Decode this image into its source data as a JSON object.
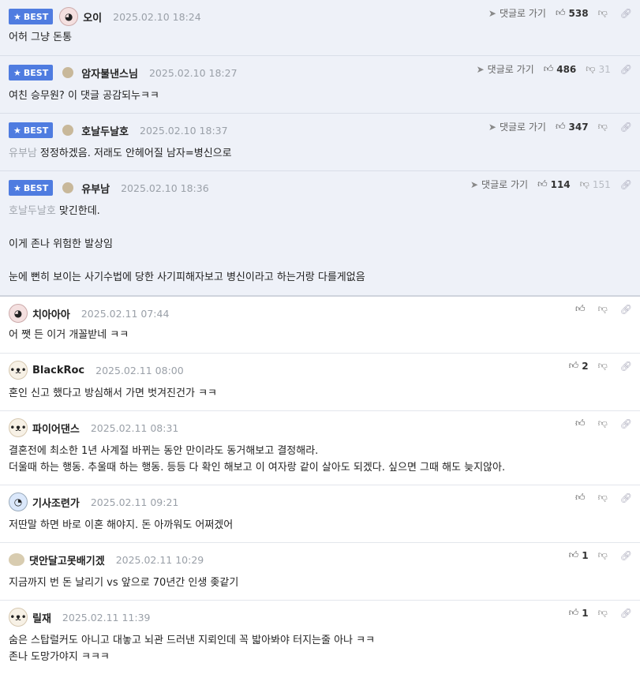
{
  "best_label": "BEST",
  "goto_label": "댓글로 가기",
  "best_comments": [
    {
      "nick": "오이",
      "date": "2025.02.10 18:24",
      "up": "538",
      "down": "",
      "mention": "",
      "lines": [
        "어허 그냥 돈통"
      ]
    },
    {
      "nick": "암자불낸스님",
      "date": "2025.02.10 18:27",
      "up": "486",
      "down": "31",
      "mention": "",
      "lines": [
        "여친 승무원? 이 댓글 공감되누ㅋㅋ"
      ]
    },
    {
      "nick": "호날두날호",
      "date": "2025.02.10 18:37",
      "up": "347",
      "down": "",
      "mention": "유부남",
      "lines": [
        "정정하겠음. 저래도 안헤어질 남자=병신으로"
      ]
    },
    {
      "nick": "유부남",
      "date": "2025.02.10 18:36",
      "up": "114",
      "down": "151",
      "mention": "호날두날호",
      "lines": [
        "맞긴한데.",
        "",
        "이게 존나 위험한 발상임",
        "",
        "눈에 뻔히 보이는 사기수법에 당한 사기피해자보고 병신이라고 하는거랑 다를게없음"
      ]
    }
  ],
  "comments": [
    {
      "nick": "치아아아",
      "date": "2025.02.11 07:44",
      "up": "",
      "lines": [
        "어 쨋 든 이거 개꼴받네 ㅋㅋ"
      ]
    },
    {
      "nick": "BlackRoc",
      "date": "2025.02.11 08:00",
      "up": "2",
      "lines": [
        "혼인 신고 했다고 방심해서 가면 벗겨진건가 ㅋㅋ"
      ]
    },
    {
      "nick": "파이어댄스",
      "date": "2025.02.11 08:31",
      "up": "",
      "lines": [
        "결혼전에 최소한 1년 사계절 바뀌는 동안 만이라도 동거해보고 결정해라.",
        "더울때 하는 행동. 추울때 하는 행동. 등등 다 확인 해보고 이 여자랑 같이 살아도 되겠다. 싶으면 그때 해도 늦지않아."
      ]
    },
    {
      "nick": "기사조련가",
      "date": "2025.02.11 09:21",
      "up": "",
      "lines": [
        "저딴말 하면 바로 이혼 해야지. 돈 아까워도 어쩌겠어"
      ]
    },
    {
      "nick": "댓안달고못배기겠",
      "date": "2025.02.11 10:29",
      "up": "1",
      "lines": [
        "지금까지 번 돈 날리기 vs 앞으로 70년간 인생 좆같기"
      ]
    },
    {
      "nick": "릴재",
      "date": "2025.02.11 11:39",
      "up": "1",
      "lines": [
        "숨은 스탑럴커도 아니고 대놓고 뇌관 드러낸 지뢰인데 꼭 밟아봐야 터지는줄 아나 ㅋㅋ",
        "존나 도망가야지 ㅋㅋㅋ"
      ]
    }
  ],
  "icons": {
    "star": "star-icon",
    "arrow": "send-arrow-icon",
    "up": "thumbs-up-icon",
    "down": "thumbs-down-icon",
    "link": "link-icon"
  }
}
